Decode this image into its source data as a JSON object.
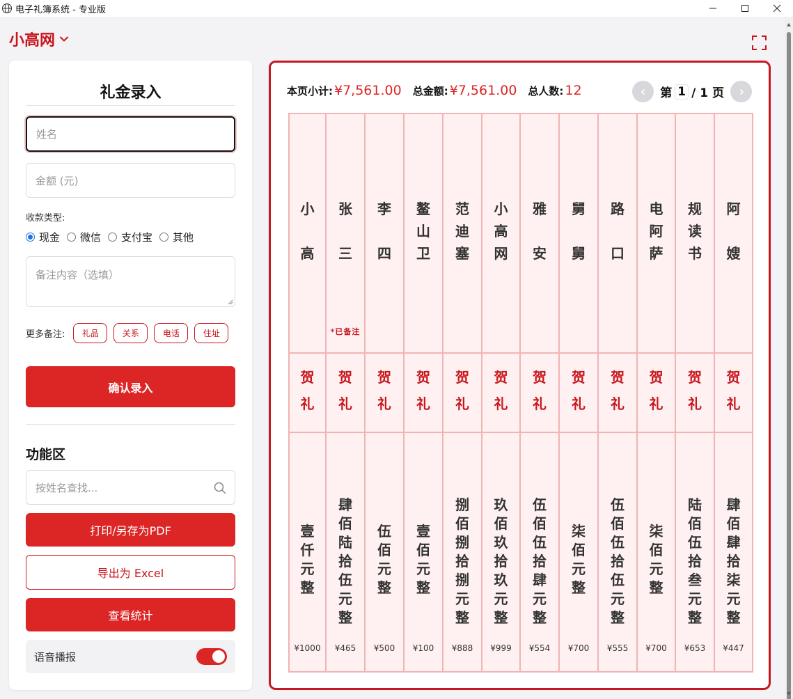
{
  "window": {
    "title": "电子礼簿系统 - 专业版",
    "icon": "globe-icon"
  },
  "header": {
    "brand": "小高网",
    "brand_icon": "chevron-down-icon",
    "fullscreen_icon": "fullscreen-icon"
  },
  "form": {
    "title": "礼金录入",
    "name_placeholder": "姓名",
    "amount_placeholder": "金额 (元)",
    "payment_label": "收款类型:",
    "payment_options": [
      "现金",
      "微信",
      "支付宝",
      "其他"
    ],
    "payment_selected": "现金",
    "note_placeholder": "备注内容（选填）",
    "more_notes_label": "更多备注:",
    "note_chips": [
      "礼品",
      "关系",
      "电话",
      "住址"
    ],
    "confirm_label": "确认录入"
  },
  "functions": {
    "title": "功能区",
    "search_placeholder": "按姓名查找...",
    "print_label": "打印/另存为PDF",
    "export_label": "导出为 Excel",
    "stats_label": "查看统计",
    "voice_label": "语音播报",
    "voice_on": true
  },
  "summary": {
    "page_subtotal_label": "本页小计:",
    "page_subtotal": "¥7,561.00",
    "total_label": "总金额:",
    "total": "¥7,561.00",
    "count_label": "总人数:",
    "count": "12"
  },
  "pager": {
    "prefix": "第",
    "current": "1",
    "suffix": "/ 1 页"
  },
  "ledger": {
    "gift_label": "贺礼",
    "note_mark": "*已备注",
    "entries": [
      {
        "name": "小高",
        "amount_cn": "壹仟元整",
        "amount": "¥1000"
      },
      {
        "name": "张三",
        "amount_cn": "肆佰陆拾伍元整",
        "amount": "¥465",
        "has_note": true
      },
      {
        "name": "李四",
        "amount_cn": "伍佰元整",
        "amount": "¥500"
      },
      {
        "name": "鳌山卫",
        "amount_cn": "壹佰元整",
        "amount": "¥100"
      },
      {
        "name": "范迪塞",
        "amount_cn": "捌佰捌拾捌元整",
        "amount": "¥888"
      },
      {
        "name": "小高网",
        "amount_cn": "玖佰玖拾玖元整",
        "amount": "¥999"
      },
      {
        "name": "雅安",
        "amount_cn": "伍佰伍拾肆元整",
        "amount": "¥554"
      },
      {
        "name": "舅舅",
        "amount_cn": "柒佰元整",
        "amount": "¥700"
      },
      {
        "name": "路口",
        "amount_cn": "伍佰伍拾伍元整",
        "amount": "¥555"
      },
      {
        "name": "电阿萨",
        "amount_cn": "柒佰元整",
        "amount": "¥700"
      },
      {
        "name": "规读书",
        "amount_cn": "陆佰伍拾叁元整",
        "amount": "¥653"
      },
      {
        "name": "阿嫂",
        "amount_cn": "肆佰肆拾柒元整",
        "amount": "¥447"
      }
    ]
  },
  "colors": {
    "accent": "#dc2626",
    "brand": "#c8161d",
    "ledger_bg": "#fff1f1",
    "ledger_border": "#f1b4b4"
  }
}
